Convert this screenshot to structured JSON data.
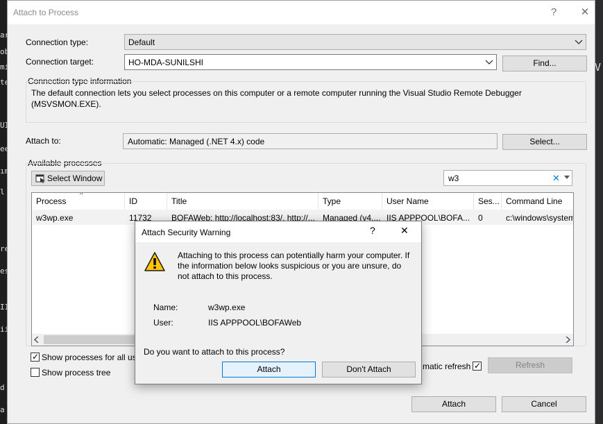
{
  "background": {
    "left_fragments": [
      "ara",
      "ob",
      "mi",
      "te",
      "UI",
      "ee",
      "ım",
      "l",
      "res",
      "es",
      "II",
      "ii",
      "d",
      "a"
    ],
    "right_fragment": "V"
  },
  "dialog": {
    "title": "Attach to Process",
    "help_glyph": "?",
    "close_glyph": "✕",
    "connection_type_label": "Connection type:",
    "connection_type_value": "Default",
    "connection_target_label": "Connection target:",
    "connection_target_value": "HO-MDA-SUNILSHI",
    "find_button": "Find...",
    "info_header": "Connection type information",
    "info_text": "The default connection lets you select processes on this computer or a remote computer running the Visual Studio Remote Debugger (MSVSMON.EXE).",
    "attach_to_label": "Attach to:",
    "attach_to_value": "Automatic: Managed (.NET 4.x) code",
    "select_button": "Select...",
    "available_processes_label": "Available processes",
    "select_window_button": "Select Window",
    "filter_value": "w3",
    "filter_clear_glyph": "✕",
    "columns": [
      "Process",
      "ID",
      "Title",
      "Type",
      "User Name",
      "Ses...",
      "Command Line"
    ],
    "rows": [
      [
        "w3wp.exe",
        "11732",
        "BOFAWeb: http://localhost:83/, http://...",
        "Managed (v4....",
        "IIS APPPOOL\\BOFA...",
        "0",
        "c:\\windows\\system"
      ]
    ],
    "show_all_users_label": "Show processes for all use",
    "show_all_users_checked": true,
    "show_process_tree_label": "Show process tree",
    "show_process_tree_checked": false,
    "auto_refresh_label": "matic refresh",
    "auto_refresh_checked": true,
    "refresh_button": "Refresh",
    "attach_button": "Attach",
    "cancel_button": "Cancel"
  },
  "warning": {
    "title": "Attach Security Warning",
    "help_glyph": "?",
    "close_glyph": "✕",
    "icon": "warning-triangle-icon",
    "message": "Attaching to this process can potentially harm your computer. If the information below looks suspicious or you are unsure, do not attach to this process.",
    "name_label": "Name:",
    "name_value": "w3wp.exe",
    "user_label": "User:",
    "user_value": "IIS APPPOOL\\BOFAWeb",
    "question": "Do you want to attach to this process?",
    "attach_button": "Attach",
    "dont_attach_button": "Don't Attach"
  },
  "colors": {
    "accent": "#0078d7",
    "warning_yellow": "#ffc40d",
    "dialog_bg": "#f0f0f0",
    "ide_bg": "#1e1e1e"
  }
}
